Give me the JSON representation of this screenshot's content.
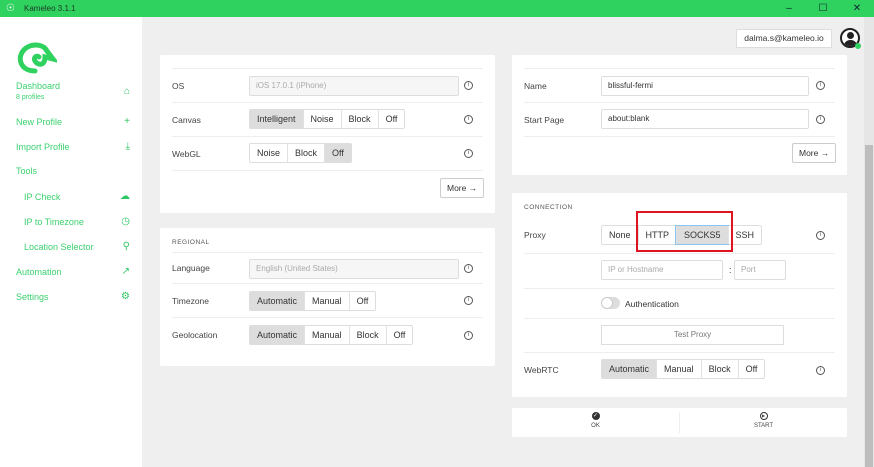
{
  "app": {
    "title": "Kameleo 3.1.1",
    "user_email": "dalma.s@kameleo.io"
  },
  "sidebar": {
    "items": [
      {
        "label": "Dashboard",
        "sub": "8 profiles",
        "icon": "home-icon"
      },
      {
        "label": "New Profile",
        "icon": "plus-icon"
      },
      {
        "label": "Import Profile",
        "icon": "import-icon"
      },
      {
        "label": "Tools"
      },
      {
        "label": "IP Check",
        "icon": "cloud-icon"
      },
      {
        "label": "IP to Timezone",
        "icon": "clock-icon"
      },
      {
        "label": "Location Selector",
        "icon": "location-pin-icon"
      },
      {
        "label": "Automation",
        "icon": "trend-icon"
      },
      {
        "label": "Settings",
        "icon": "gear-icon"
      }
    ]
  },
  "fingerprint": {
    "os_label": "OS",
    "os_value": "iOS 17.0.1 (iPhone)",
    "canvas_label": "Canvas",
    "canvas_options": [
      "Intelligent",
      "Noise",
      "Block",
      "Off"
    ],
    "webgl_label": "WebGL",
    "webgl_options": [
      "Noise",
      "Block",
      "Off"
    ],
    "more": "More"
  },
  "regional": {
    "title": "REGIONAL",
    "language_label": "Language",
    "language_value": "English (United States)",
    "timezone_label": "Timezone",
    "timezone_options": [
      "Automatic",
      "Manual",
      "Off"
    ],
    "geo_label": "Geolocation",
    "geo_options": [
      "Automatic",
      "Manual",
      "Block",
      "Off"
    ]
  },
  "general": {
    "name_label": "Name",
    "name_value": "blissful-fermi",
    "start_label": "Start Page",
    "start_value": "about:blank",
    "more": "More"
  },
  "connection": {
    "title": "CONNECTION",
    "proxy_label": "Proxy",
    "proxy_options": [
      "None",
      "HTTP",
      "SOCKS5",
      "SSH"
    ],
    "host_placeholder": "IP or Hostname",
    "port_placeholder": "Port",
    "auth_label": "Authentication",
    "test_proxy": "Test Proxy",
    "webrtc_label": "WebRTC",
    "webrtc_options": [
      "Automatic",
      "Manual",
      "Block",
      "Off"
    ]
  },
  "actions": {
    "ok": "OK",
    "start": "START"
  },
  "colors": {
    "brand": "#2fd15f",
    "highlight": "#e0141e"
  }
}
